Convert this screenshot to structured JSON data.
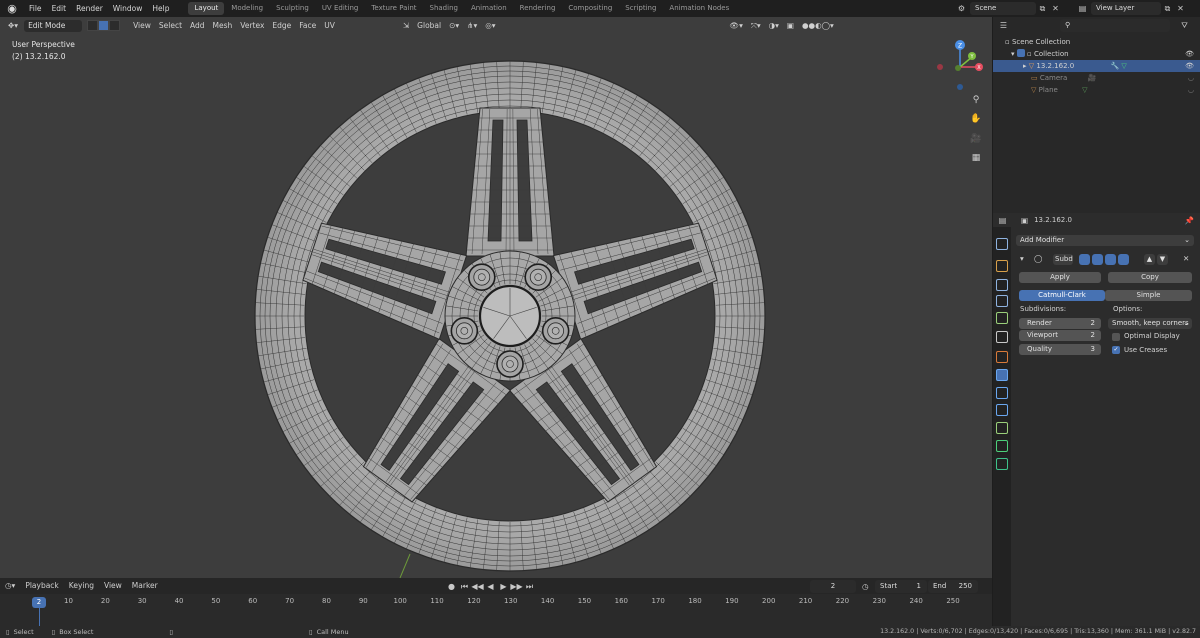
{
  "menu": {
    "items": [
      "File",
      "Edit",
      "Render",
      "Window",
      "Help"
    ]
  },
  "workspaces": [
    "Layout",
    "Modeling",
    "Sculpting",
    "UV Editing",
    "Texture Paint",
    "Shading",
    "Animation",
    "Rendering",
    "Compositing",
    "Scripting",
    "Animation Nodes"
  ],
  "active_workspace": "Layout",
  "scene": {
    "name": "Scene",
    "view_layer": "View Layer"
  },
  "viewport": {
    "mode": "Edit Mode",
    "header_menus": [
      "View",
      "Select",
      "Add",
      "Mesh",
      "Vertex",
      "Edge",
      "Face",
      "UV"
    ],
    "orientation": "Global",
    "perspective": "User Perspective",
    "object_info": "(2) 13.2.162.0",
    "gizmo_axes": {
      "z": "Z",
      "y": "Y",
      "x": "X"
    },
    "axis_colors": {
      "x": "#e64d60",
      "y": "#7fbf3f",
      "z": "#4a8fe6"
    }
  },
  "outliner": {
    "rows": [
      {
        "label": "Scene Collection",
        "state": "normal"
      },
      {
        "label": "Collection",
        "state": "normal"
      },
      {
        "label": "13.2.162.0",
        "state": "selected"
      },
      {
        "label": "Camera",
        "state": "dim"
      },
      {
        "label": "Plane",
        "state": "dim"
      }
    ]
  },
  "properties": {
    "object_name": "13.2.162.0",
    "add_modifier": "Add Modifier",
    "modifier_name": "Subd",
    "apply": "Apply",
    "copy": "Copy",
    "catmull_clark": "Catmull-Clark",
    "simple": "Simple",
    "subdivisions_label": "Subdivisions:",
    "options_label": "Options:",
    "render_label": "Render",
    "render_value": "2",
    "viewport_label": "Viewport",
    "viewport_value": "2",
    "quality_label": "Quality",
    "quality_value": "3",
    "uv_smooth": "Smooth, keep corners",
    "optimal_display": "Optimal Display",
    "use_creases": "Use Creases",
    "optimal_display_checked": false,
    "use_creases_checked": true
  },
  "timeline": {
    "menus": [
      "Playback",
      "Keying",
      "View",
      "Marker"
    ],
    "current_frame": "2",
    "start_label": "Start",
    "start_value": "1",
    "end_label": "End",
    "end_value": "250",
    "ruler_frames": [
      "10",
      "20",
      "30",
      "40",
      "50",
      "60",
      "70",
      "80",
      "90",
      "100",
      "110",
      "120",
      "130",
      "140",
      "150",
      "160",
      "170",
      "180",
      "190",
      "200",
      "210",
      "220",
      "230",
      "240",
      "250"
    ]
  },
  "statusbar": {
    "select": "Select",
    "box_select": "Box Select",
    "call_menu": "Call Menu",
    "stats": "13.2.162.0 | Verts:0/6,702 | Edges:0/13,420 | Faces:0/6,695 | Tris:13,360 | Mem: 361.1 MiB | v2.82.7"
  },
  "colors": {
    "accent": "#4772b3",
    "viewport_bg": "#3d3d3d",
    "mesh_fill": "#a4a4a4",
    "wire": "#2a2a2a"
  }
}
